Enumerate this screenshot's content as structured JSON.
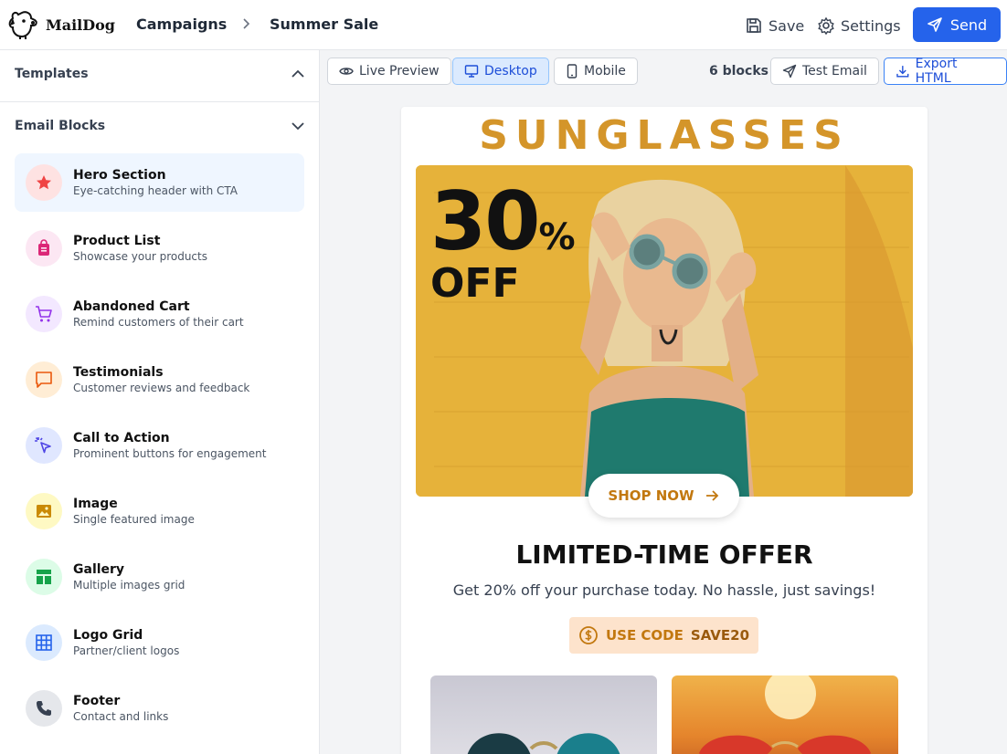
{
  "app": {
    "name": "MailDog"
  },
  "breadcrumb": {
    "parent": "Campaigns",
    "current": "Summer Sale"
  },
  "toolbar": {
    "save": "Save",
    "settings": "Settings",
    "send": "Send"
  },
  "sidebar": {
    "templates_title": "Templates",
    "blocks_title": "Email Blocks",
    "items": [
      {
        "title": "Hero Section",
        "desc": "Eye-catching header with CTA",
        "icon": "star-icon",
        "color": "#ef4444",
        "bg": "#fee2e2"
      },
      {
        "title": "Product List",
        "desc": "Showcase your products",
        "icon": "shopping-bag-icon",
        "color": "#db2777",
        "bg": "#fce7f3"
      },
      {
        "title": "Abandoned Cart",
        "desc": "Remind customers of their cart",
        "icon": "shopping-cart-icon",
        "color": "#9333ea",
        "bg": "#f3e8ff"
      },
      {
        "title": "Testimonials",
        "desc": "Customer reviews and feedback",
        "icon": "message-square-icon",
        "color": "#ea580c",
        "bg": "#ffedd5"
      },
      {
        "title": "Call to Action",
        "desc": "Prominent buttons for engagement",
        "icon": "pointer-click-icon",
        "color": "#4f46e5",
        "bg": "#e0e7ff"
      },
      {
        "title": "Image",
        "desc": "Single featured image",
        "icon": "image-icon",
        "color": "#ca8a04",
        "bg": "#fef9c3"
      },
      {
        "title": "Gallery",
        "desc": "Multiple images grid",
        "icon": "layout-icon",
        "color": "#16a34a",
        "bg": "#dcfce7"
      },
      {
        "title": "Logo Grid",
        "desc": "Partner/client logos",
        "icon": "grid-icon",
        "color": "#2563eb",
        "bg": "#dbeafe"
      },
      {
        "title": "Footer",
        "desc": "Contact and links",
        "icon": "phone-icon",
        "color": "#374151",
        "bg": "#e5e7eb"
      }
    ]
  },
  "preview": {
    "live_preview": "Live Preview",
    "desktop": "Desktop",
    "mobile": "Mobile",
    "blocks_count": "6 blocks",
    "test_email": "Test Email",
    "export_html": "Export HTML"
  },
  "email": {
    "brand": "SUNGLASSES",
    "discount_number": "30",
    "discount_symbol": "%",
    "discount_word": "OFF",
    "shop_button": "SHOP NOW",
    "offer_title": "LIMITED-TIME OFFER",
    "offer_text": "Get 20% off your purchase today. No hassle, just savings!",
    "code_label": "USE CODE",
    "code_value": "SAVE20"
  },
  "colors": {
    "accent": "#2563eb",
    "brand": "#d4952a"
  }
}
